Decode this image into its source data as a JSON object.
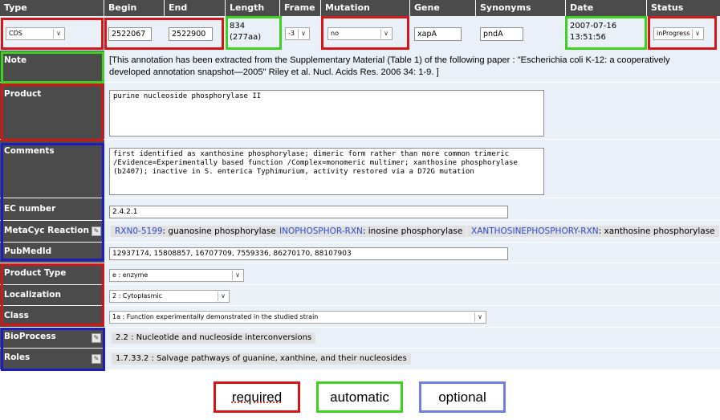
{
  "columns": {
    "type": "Type",
    "begin": "Begin",
    "end": "End",
    "length": "Length",
    "frame": "Frame",
    "mutation": "Mutation",
    "gene": "Gene",
    "synonyms": "Synonyms",
    "date": "Date",
    "status": "Status"
  },
  "record": {
    "type_value": "CDS",
    "begin_value": "2522067",
    "end_value": "2522900",
    "length_line1": "834",
    "length_line2": "(277aa)",
    "frame_value": "-3",
    "mutation_value": "no",
    "gene_value": "xapA",
    "synonyms_value": "pndA",
    "date_line1": "2007-07-16",
    "date_line2": "13:51:56",
    "status_value": "inProgress"
  },
  "fields": {
    "note": {
      "label": "Note",
      "value": "[This annotation has been extracted from the Supplementary Material (Table 1) of the following paper : \"Escherichia coli K-12: a cooperatively developed annotation snapshot—2005\" Riley et al. Nucl. Acids Res. 2006 34: 1-9. ]"
    },
    "product": {
      "label": "Product",
      "value": "purine nucleoside phosphorylase II"
    },
    "comments": {
      "label": "Comments",
      "value": "first identified as xanthosine phosphorylase; dimeric form rather than more common trimeric\n/Evidence=Experimentally based function /Complex=monomeric multimer; xanthosine phosphorylase\n(b2407); inactive in S. enterica Typhimurium, activity restored via a D72G mutation"
    },
    "ec_number": {
      "label": "EC number",
      "value": "2.4.2.1"
    },
    "metacyc": {
      "label": "MetaCyc Reaction",
      "reactions": [
        {
          "id": "RXN0-5199",
          "name": ": guanosine phosphorylase"
        },
        {
          "id": "INOPHOSPHOR-RXN",
          "name": ": inosine phosphorylase"
        },
        {
          "id": "XANTHOSINEPHOSPHORY-RXN",
          "name": ": xanthosine phosphorylase"
        }
      ]
    },
    "pubmed": {
      "label": "PubMedId",
      "value": "12937174, 15808857, 16707709, 7559336, 86270170, 88107903"
    },
    "product_type": {
      "label": "Product Type",
      "value": "e : enzyme"
    },
    "localization": {
      "label": "Localization",
      "value": "2 : Cytoplasmic"
    },
    "class": {
      "label": "Class",
      "value": "1a : Function experimentally demonstrated in the studied strain"
    },
    "bioprocess": {
      "label": "BioProcess",
      "value": "2.2 : Nucleotide and nucleoside interconversions"
    },
    "roles": {
      "label": "Roles",
      "value": "1.7.33.2 : Salvage pathways of guanine, xanthine, and their nucleosides"
    }
  },
  "legend": {
    "required": "required",
    "automatic": "automatic",
    "optional": "optional",
    "colors": {
      "required": "#d41616",
      "automatic": "#3fd11f",
      "optional": "#1c1cc0"
    }
  },
  "icons": {
    "edit": "edit-icon",
    "dropdown": "chevron-down-icon"
  }
}
